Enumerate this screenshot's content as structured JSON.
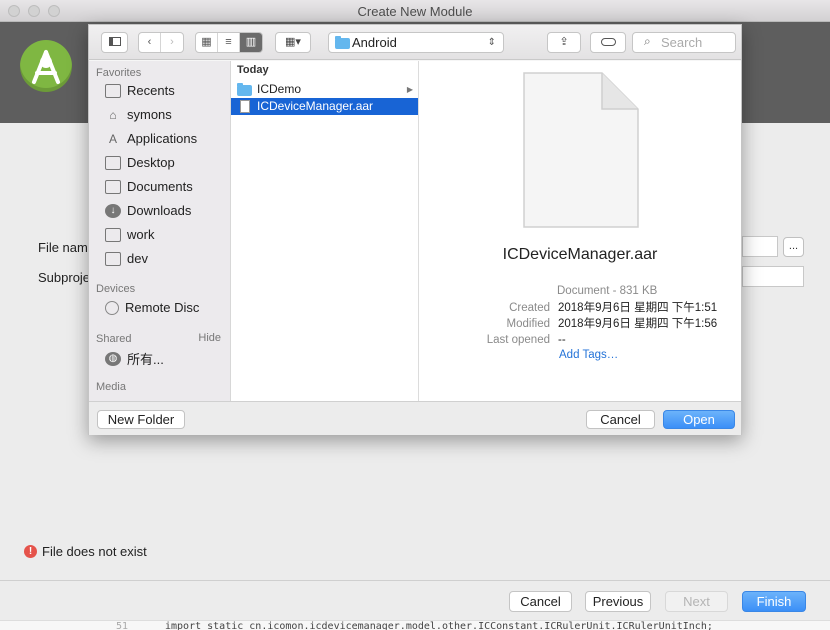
{
  "window": {
    "title": "Create New Module"
  },
  "wizard": {
    "file_name_label": "File name",
    "subproject_label": "Subproje",
    "ellipsis_label": "...",
    "error_text": "File does not exist",
    "buttons": {
      "cancel": "Cancel",
      "previous": "Previous",
      "next": "Next",
      "finish": "Finish"
    }
  },
  "open_sheet": {
    "toolbar": {
      "location": "Android",
      "search_placeholder": "Search"
    },
    "sidebar": {
      "favorites_header": "Favorites",
      "favorites": [
        "Recents",
        "symons",
        "Applications",
        "Desktop",
        "Documents",
        "Downloads",
        "work",
        "dev"
      ],
      "devices_header": "Devices",
      "devices": [
        "Remote Disc"
      ],
      "shared_header": "Shared",
      "shared_hide": "Hide",
      "shared": [
        "所有..."
      ],
      "media_header": "Media"
    },
    "column": {
      "header": "Today",
      "items": [
        {
          "name": "ICDemo",
          "kind": "folder"
        },
        {
          "name": "ICDeviceManager.aar",
          "kind": "file",
          "selected": true
        }
      ]
    },
    "preview": {
      "name": "ICDeviceManager.aar",
      "kind_size": "Document - 831 KB",
      "created_label": "Created",
      "created_value": "2018年9月6日 星期四 下午1:51",
      "modified_label": "Modified",
      "modified_value": "2018年9月6日 星期四 下午1:56",
      "last_opened_label": "Last opened",
      "last_opened_value": "--",
      "add_tags": "Add Tags…"
    },
    "footer": {
      "new_folder": "New Folder",
      "cancel": "Cancel",
      "open": "Open"
    }
  },
  "editor_strip": {
    "line_number": "51",
    "code": "import static cn.icomon.icdevicemanager.model.other.ICConstant.ICRulerUnit.ICRulerUnitInch;"
  },
  "colors": {
    "accent": "#3b8ff7",
    "selection": "#1864d5",
    "header_bg": "#5e5e5e",
    "logo": "#7fb742",
    "error": "#e5534b"
  }
}
